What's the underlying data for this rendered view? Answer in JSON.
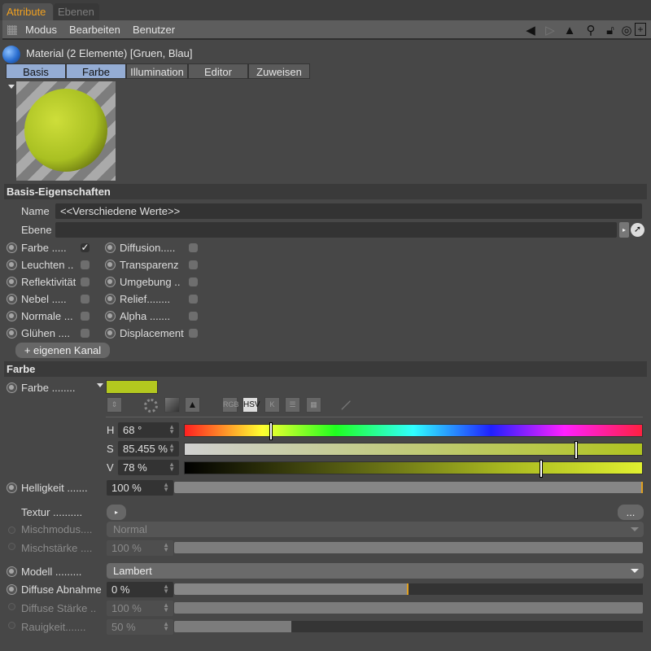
{
  "panel_tabs": [
    {
      "label": "Attribute",
      "active": true
    },
    {
      "label": "Ebenen",
      "active": false
    }
  ],
  "menu": [
    "Modus",
    "Bearbeiten",
    "Benutzer"
  ],
  "toolbar_icons": [
    "back-arrow-icon",
    "forward-arrow-icon",
    "up-arrow-icon",
    "search-icon",
    "lock-icon",
    "target-icon",
    "new-panel-icon"
  ],
  "material_title": "Material (2 Elemente) [Gruen, Blau]",
  "sub_tabs": [
    {
      "label": "Basis",
      "active": true
    },
    {
      "label": "Farbe",
      "active": true
    },
    {
      "label": "Illumination",
      "active": false
    },
    {
      "label": "Editor",
      "active": false
    },
    {
      "label": "Zuweisen",
      "active": false
    }
  ],
  "basis": {
    "header": "Basis-Eigenschaften",
    "name_label": "Name",
    "name_value": "<<Verschiedene Werte>>",
    "ebene_label": "Ebene",
    "ebene_value": "",
    "channels_left": [
      {
        "label": "Farbe .....",
        "checked": true
      },
      {
        "label": "Leuchten ..",
        "checked": false
      },
      {
        "label": "Reflektivität",
        "checked": false
      },
      {
        "label": "Nebel .....",
        "checked": false
      },
      {
        "label": "Normale ...",
        "checked": false
      },
      {
        "label": "Glühen ....",
        "checked": false
      }
    ],
    "channels_right": [
      {
        "label": "Diffusion.....",
        "checked": false
      },
      {
        "label": "Transparenz",
        "checked": false
      },
      {
        "label": "Umgebung ..",
        "checked": false
      },
      {
        "label": "Relief........",
        "checked": false
      },
      {
        "label": "Alpha .......",
        "checked": false
      },
      {
        "label": "Displacement",
        "checked": false
      }
    ],
    "add_channel": "+ eigenen Kanal"
  },
  "farbe": {
    "header": "Farbe",
    "color_label": "Farbe ........",
    "swatch": "#b3c81f",
    "mode_icons": [
      "RGB",
      "HSV",
      "K"
    ],
    "h_label": "H",
    "h_value": "68 °",
    "h_fraction": 0.189,
    "s_label": "S",
    "s_value": "85.455 %",
    "s_fraction": 0.855,
    "v_label": "V",
    "v_value": "78 %",
    "v_fraction": 0.78,
    "helligkeit_label": "Helligkeit .......",
    "helligkeit_value": "100 %",
    "helligkeit_fraction": 1.0,
    "textur_label": "Textur ..........",
    "textur_more": "...",
    "mischmodus_label": "Mischmodus....",
    "mischmodus_value": "Normal",
    "mischstaerke_label": "Mischstärke ....",
    "mischstaerke_value": "100 %",
    "mischstaerke_fraction": 1.0,
    "modell_label": "Modell .........",
    "modell_value": "Lambert",
    "diffuse_abnahme_label": "Diffuse Abnahme",
    "diffuse_abnahme_value": "0 %",
    "diffuse_abnahme_fraction": 0.5,
    "diffuse_staerke_label": "Diffuse Stärke ..",
    "diffuse_staerke_value": "100 %",
    "diffuse_staerke_fraction": 1.0,
    "rauigkeit_label": "Rauigkeit.......",
    "rauigkeit_value": "50 %",
    "rauigkeit_fraction": 0.25
  }
}
